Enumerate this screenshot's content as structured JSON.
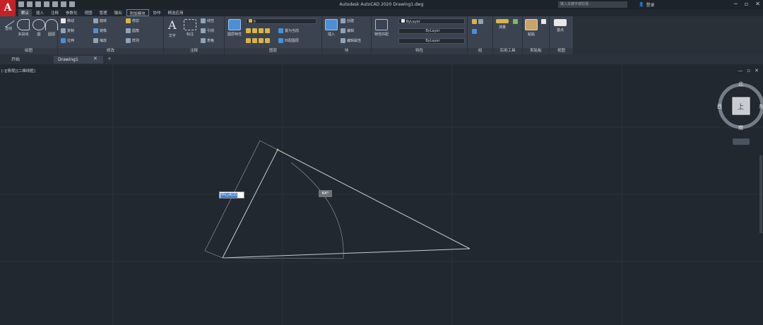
{
  "app": {
    "logo": "A",
    "title": "Autodesk AutoCAD 2020  Drawing1.dwg",
    "search_placeholder": "键入关键字或短语",
    "login": "登录"
  },
  "tabs": [
    "默认",
    "插入",
    "注释",
    "参数化",
    "视图",
    "管理",
    "输出",
    "附加模块",
    "协作",
    "精选应用"
  ],
  "ribbon": {
    "draw": {
      "title": "绘图",
      "buttons": [
        "直线",
        "多段线",
        "圆",
        "圆弧"
      ]
    },
    "modify": {
      "title": "修改",
      "buttons": [
        "移动",
        "旋转",
        "修剪",
        "复制",
        "镜像",
        "圆角",
        "拉伸",
        "缩放",
        "阵列"
      ]
    },
    "annotation": {
      "title": "注释",
      "buttons": [
        "文字",
        "标注",
        "线性",
        "引线",
        "表格"
      ]
    },
    "layers": {
      "title": "图层",
      "buttons": [
        "图层特性",
        "置为当前",
        "匹配图层"
      ],
      "current_layer": "0"
    },
    "block": {
      "title": "块",
      "buttons": [
        "插入",
        "创建",
        "编辑",
        "编辑属性"
      ]
    },
    "properties": {
      "title": "特性",
      "buttons": [
        "特性匹配"
      ],
      "color": "ByLayer",
      "linetype": "ByLayer",
      "lineweight": "ByLayer"
    },
    "groups": {
      "title": "组"
    },
    "utilities": {
      "title": "实用工具",
      "buttons": [
        "测量"
      ]
    },
    "clipboard": {
      "title": "剪贴板",
      "buttons": [
        "粘贴"
      ]
    },
    "view": {
      "title": "视图",
      "buttons": [
        "基点"
      ]
    }
  },
  "doc_tabs": {
    "start": "开始",
    "drawing": "Drawing1",
    "close": "✕",
    "add": "+"
  },
  "viewport": {
    "label": "[-][俯视][二维线框]",
    "controls": [
      "—",
      "▫",
      "✕"
    ]
  },
  "viewcube": {
    "north": "北",
    "south": "南",
    "west": "西",
    "east": "东",
    "face": "上"
  },
  "dynamic_input": {
    "length_value": "中心点(2)",
    "angle_value": "64°"
  },
  "colors": {
    "canvas": "#212830",
    "geometry": "#c8cdd2",
    "accent": "#3c7fd6"
  }
}
